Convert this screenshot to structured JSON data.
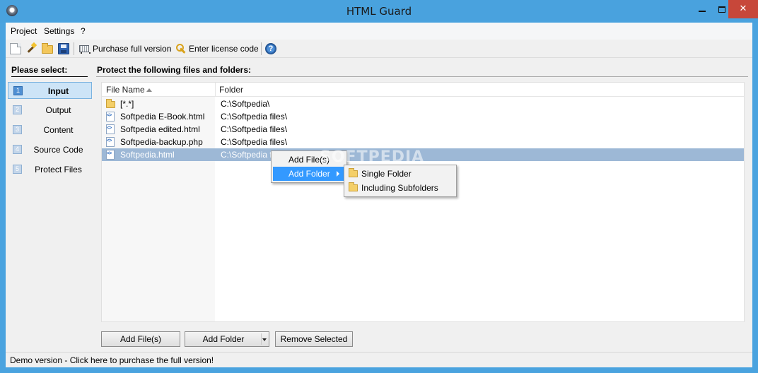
{
  "window": {
    "title": "HTML Guard",
    "controls": {
      "minimize": "—",
      "maximize": "□",
      "close": "✕"
    }
  },
  "menu": [
    "Project",
    "Settings",
    "?"
  ],
  "toolbar": {
    "icons": [
      "new-file-icon",
      "wizard-wand-icon",
      "open-folder-icon",
      "save-icon",
      "cart-icon",
      "key-icon",
      "help-icon"
    ],
    "purchase_label": "Purchase full version",
    "license_label": "Enter license code"
  },
  "sidebar": {
    "title": "Please select:",
    "items": [
      {
        "num": "1",
        "label": "Input",
        "active": true
      },
      {
        "num": "2",
        "label": "Output",
        "active": false
      },
      {
        "num": "3",
        "label": "Content",
        "active": false
      },
      {
        "num": "4",
        "label": "Source Code",
        "active": false
      },
      {
        "num": "5",
        "label": "Protect Files",
        "active": false
      }
    ]
  },
  "main": {
    "title": "Protect the following files and folders:",
    "columns": {
      "name": "File Name",
      "folder": "Folder"
    },
    "rows": [
      {
        "icon": "folder",
        "name": "[*.*]",
        "folder": "C:\\Softpedia\\"
      },
      {
        "icon": "html",
        "name": "Softpedia E-Book.html",
        "folder": "C:\\Softpedia files\\"
      },
      {
        "icon": "html",
        "name": "Softpedia edited.html",
        "folder": "C:\\Softpedia files\\"
      },
      {
        "icon": "html",
        "name": "Softpedia-backup.php",
        "folder": "C:\\Softpedia files\\"
      },
      {
        "icon": "html",
        "name": "Softpedia.html",
        "folder": "C:\\Softpedia fil",
        "selected": true
      }
    ],
    "buttons": {
      "add_files": "Add File(s)",
      "add_folder": "Add Folder",
      "remove_selected": "Remove Selected"
    }
  },
  "context_menu": {
    "items": [
      {
        "label": "Add File(s)",
        "highlighted": false
      },
      {
        "label": "Add Folder",
        "highlighted": true,
        "submenu": true
      }
    ],
    "submenu": [
      "Single Folder",
      "Including Subfolders"
    ]
  },
  "watermark": "SOFTPEDIA",
  "status": {
    "text": "Demo version - Click here to purchase the full version!"
  }
}
